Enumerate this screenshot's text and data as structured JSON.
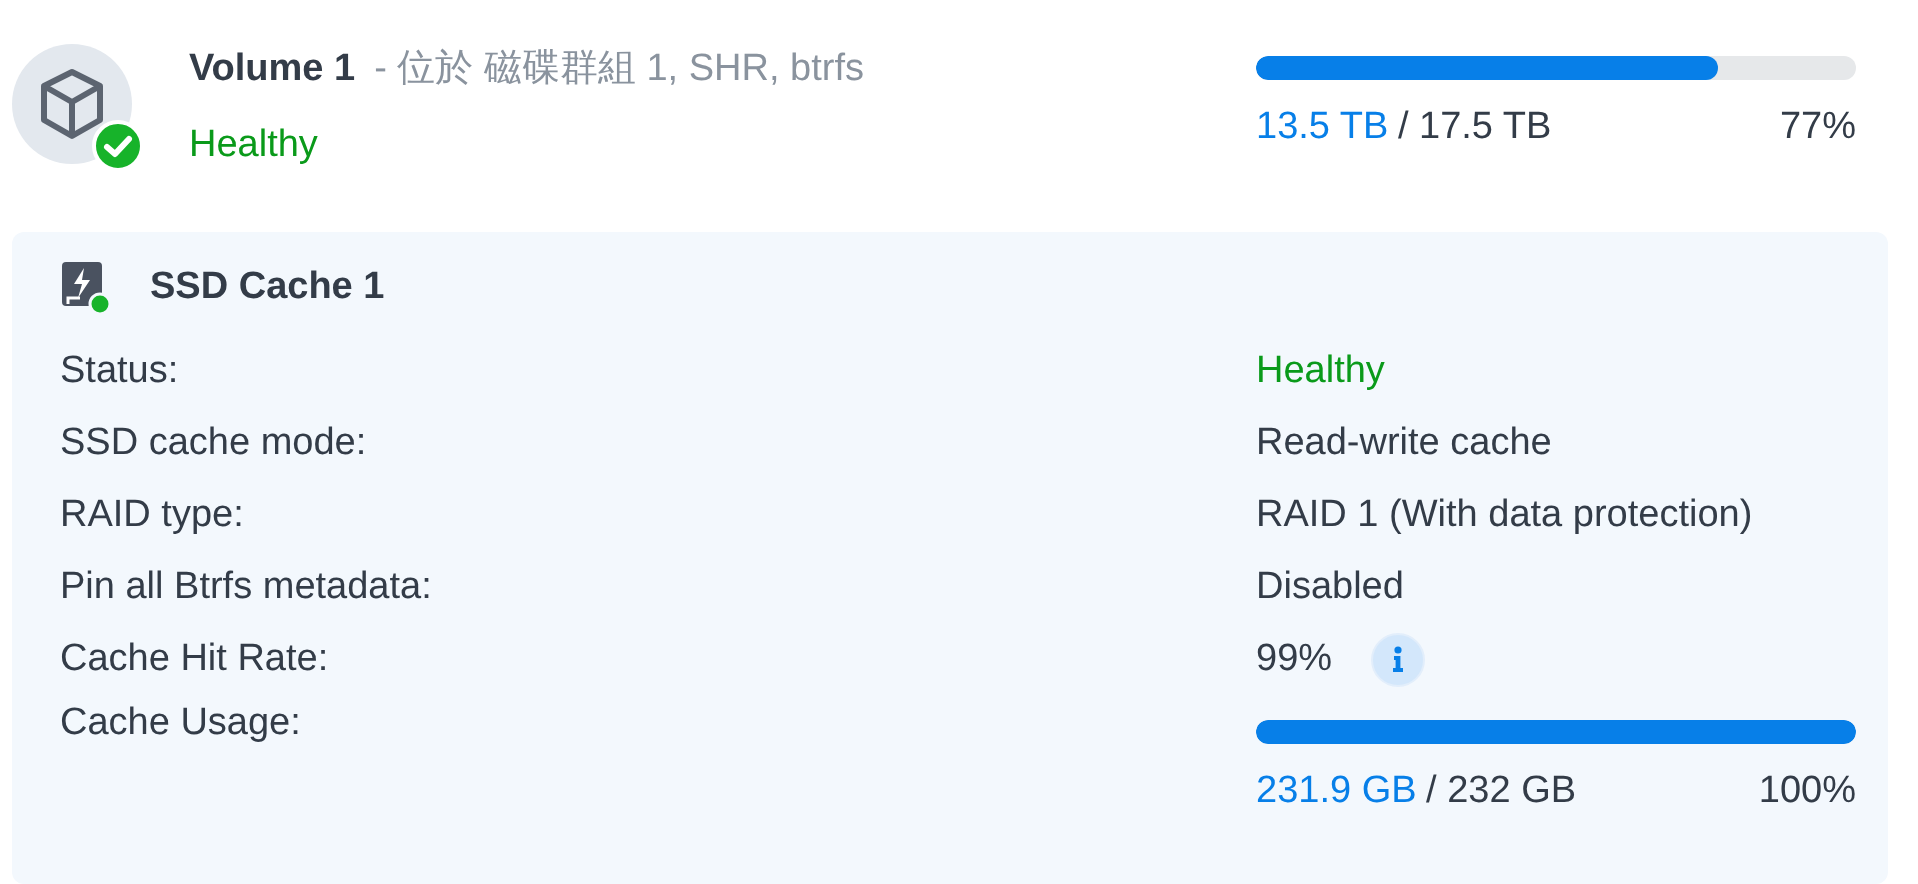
{
  "volume": {
    "name": "Volume 1",
    "detail": "- 位於 磁碟群組 1, SHR, btrfs",
    "status": "Healthy",
    "usage": {
      "used": "13.5 TB",
      "total": "/ 17.5 TB",
      "percent": "77%",
      "level": 0.77
    }
  },
  "cache": {
    "title": "SSD Cache 1",
    "rows": [
      {
        "label": "Status:",
        "kind": "status",
        "value": "Healthy"
      },
      {
        "label": "SSD cache mode:",
        "kind": "text",
        "value": "Read-write cache"
      },
      {
        "label": "RAID type:",
        "kind": "text",
        "value": "RAID 1 (With data protection)"
      },
      {
        "label": "Pin all Btrfs metadata:",
        "kind": "text",
        "value": "Disabled"
      },
      {
        "label": "Cache Hit Rate:",
        "kind": "info",
        "value": "99%"
      },
      {
        "label": "Cache Usage:",
        "kind": "usage",
        "used": "231.9 GB",
        "total": "/ 232 GB",
        "percent": "100%",
        "level": 1.0
      }
    ]
  }
}
